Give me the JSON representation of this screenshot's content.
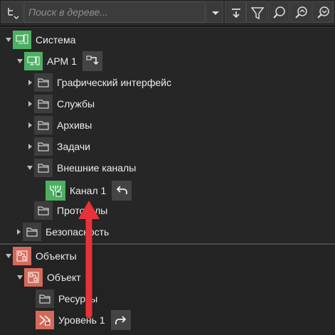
{
  "toolbar": {
    "search_placeholder": "Поиск в дереве...",
    "icons": [
      "tree-expand-icon",
      "dropdown-icon",
      "collapse-all-icon",
      "filter-icon",
      "search-icon",
      "zoom-in-icon",
      "zoom-out-icon"
    ]
  },
  "tree": {
    "system": "Система",
    "arm": "АРМ 1",
    "gui": "Графический интерфейс",
    "services": "Службы",
    "archives": "Архивы",
    "tasks": "Задачи",
    "external_channels": "Внешние каналы",
    "channel": "Канал 1",
    "protocols": "Протоколы",
    "security": "Безопасность"
  },
  "objects": {
    "root": "Объекты",
    "object": "Объект",
    "resources": "Ресурсы",
    "level": "Уровень 1"
  },
  "colors": {
    "green": "#4caf62",
    "red": "#d46a5a",
    "highlight_arrow": "#e8323a"
  }
}
